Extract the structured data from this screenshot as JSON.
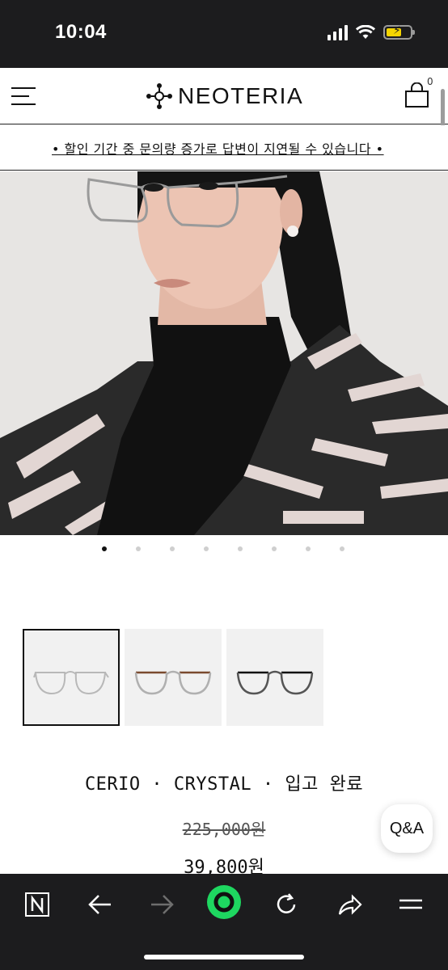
{
  "status_bar": {
    "time": "10:04"
  },
  "header": {
    "logo_text": "NEOTERIA",
    "cart_count": "0"
  },
  "notice": {
    "text": "•  할인 기간 중 문의량 증가로 답변이 지연될 수 있습니다  •"
  },
  "carousel": {
    "total_slides": 8,
    "active_index": 0
  },
  "thumbnails": [
    {
      "name": "clear-frame",
      "selected": true
    },
    {
      "name": "brown-frame",
      "selected": false
    },
    {
      "name": "black-frame",
      "selected": false
    }
  ],
  "product": {
    "name": "CERIO · CRYSTAL · 입고 완료",
    "original_price": "225,000원",
    "sale_price": "39,800원"
  },
  "qa_button": {
    "label": "Q&A"
  },
  "colors": {
    "accent_green": "#1ed760",
    "dark_bar": "#1c1c1e"
  },
  "bottom_bar": {
    "icons": [
      "naver-n-icon",
      "back-arrow-icon",
      "forward-arrow-icon",
      "green-home-icon",
      "reload-icon",
      "share-icon",
      "menu-icon"
    ]
  }
}
